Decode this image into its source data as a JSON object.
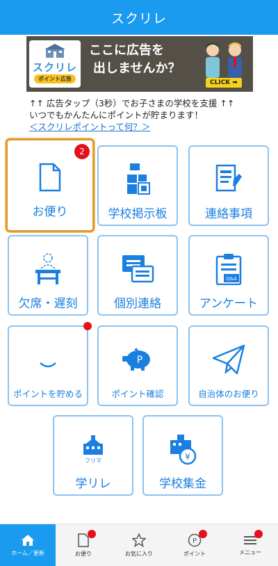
{
  "header": {
    "title": "スクリレ"
  },
  "banner": {
    "logo_text": "スクリレ",
    "logo_sub": "ポイント広告",
    "line1": "ここに広告を",
    "line2": "出しませんか？",
    "click": "CLICK ➡"
  },
  "info": {
    "line1": "↑↑ 広告タップ（3秒）でお子さまの学校を支援 ↑↑",
    "line2": "いつでもかんたんにポイントが貯まります！",
    "link": "＜スクリレポイントって何？＞"
  },
  "tiles": [
    {
      "label": "お便り",
      "icon": "document-icon",
      "badge": "2"
    },
    {
      "label": "学校掲示板",
      "icon": "bulletin-board-icon"
    },
    {
      "label": "連絡事項",
      "icon": "notice-icon"
    },
    {
      "label": "欠席・遅刻",
      "icon": "desk-absence-icon"
    },
    {
      "label": "個別連絡",
      "icon": "chat-bubbles-icon"
    },
    {
      "label": "アンケート",
      "icon": "survey-clipboard-icon"
    },
    {
      "label": "ポイントを貯める",
      "icon": "smile-icon"
    },
    {
      "label": "ポイント確認",
      "icon": "piggy-bank-icon"
    },
    {
      "label": "自治体のお便り",
      "icon": "paper-plane-icon"
    },
    {
      "label": "学リレ",
      "icon": "school-flea-market-icon",
      "icon_text": "フリマ"
    },
    {
      "label": "学校集金",
      "icon": "school-money-icon"
    }
  ],
  "footer": [
    {
      "label": "ホーム／更新",
      "icon": "home-icon",
      "active": true
    },
    {
      "label": "お便り",
      "icon": "document-icon"
    },
    {
      "label": "お気に入り",
      "icon": "star-icon"
    },
    {
      "label": "ポイント",
      "icon": "point-coin-icon"
    },
    {
      "label": "メニュー",
      "icon": "menu-icon"
    }
  ],
  "colors": {
    "primary": "#1a9bf0",
    "tile_text": "#1a7fe0",
    "tile_border": "#8cc2f0",
    "selected_border": "#e19a2c",
    "badge": "#e5101b"
  }
}
